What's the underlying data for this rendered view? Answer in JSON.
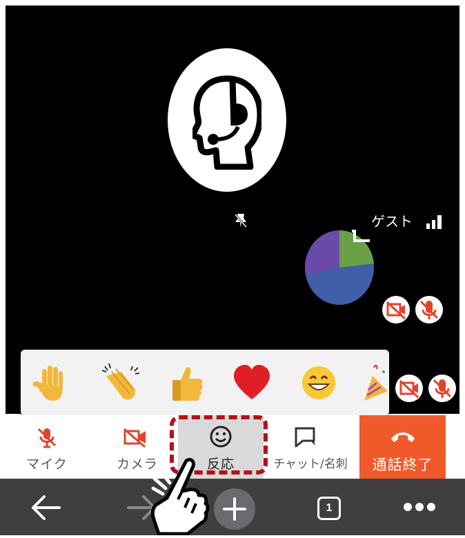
{
  "participant": {
    "name": "ゲスト"
  },
  "icons": {
    "avatar": "headset-person-icon",
    "pin": "pin-off-icon",
    "signal": "signal-strength-icon",
    "camera_off": "camera-off-icon",
    "mic_off": "mic-off-icon"
  },
  "reactions": [
    {
      "name": "raised-hand",
      "emoji": "✋"
    },
    {
      "name": "clapping-hands",
      "emoji": "👏"
    },
    {
      "name": "thumbs-up",
      "emoji": "👍"
    },
    {
      "name": "heart",
      "emoji": "❤️"
    },
    {
      "name": "grinning-face",
      "emoji": "😄"
    },
    {
      "name": "party-popper",
      "emoji": "🎉"
    }
  ],
  "toolbar": {
    "mic_label": "マイク",
    "camera_label": "カメラ",
    "reaction_label": "反応",
    "chat_label": "チャット/名刺",
    "end_call_label": "通話終了"
  },
  "browser_nav": {
    "tab_count": "1"
  },
  "colors": {
    "accent_red": "#ef5a2a",
    "highlight": "#b3121b",
    "toolbar_selected": "#d9d9d9",
    "nav_bg": "#3f3f42"
  }
}
